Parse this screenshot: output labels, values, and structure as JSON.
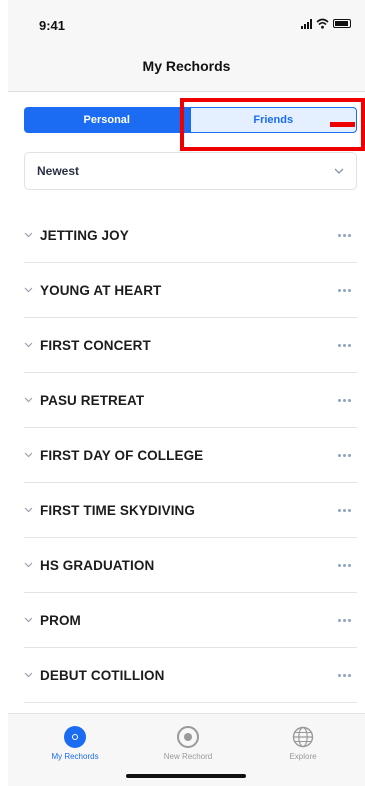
{
  "status_bar": {
    "time": "9:41",
    "icons": [
      "signal-icon",
      "wifi-icon",
      "battery-icon"
    ]
  },
  "header": {
    "title": "My Rechords"
  },
  "segments": {
    "personal": "Personal",
    "friends": "Friends",
    "selected": "Personal"
  },
  "sort": {
    "selected": "Newest",
    "icon": "chevron-down-icon"
  },
  "list": {
    "items": [
      {
        "label": "JETTING JOY"
      },
      {
        "label": "YOUNG AT HEART"
      },
      {
        "label": "FIRST CONCERT"
      },
      {
        "label": "PASU RETREAT"
      },
      {
        "label": "FIRST DAY OF COLLEGE"
      },
      {
        "label": "FIRST TIME SKYDIVING"
      },
      {
        "label": "HS GRADUATION"
      },
      {
        "label": "PROM"
      },
      {
        "label": "DEBUT COTILLION"
      }
    ]
  },
  "tabbar": {
    "tabs": [
      {
        "label": "My Rechords",
        "icon": "my-rechords-icon",
        "active": true
      },
      {
        "label": "New Rechord",
        "icon": "record-icon",
        "active": false
      },
      {
        "label": "Explore",
        "icon": "globe-icon",
        "active": false
      }
    ]
  },
  "colors": {
    "accent": "#1b6cf2",
    "highlight": "#ee0000",
    "muted": "#9a9a9a"
  }
}
